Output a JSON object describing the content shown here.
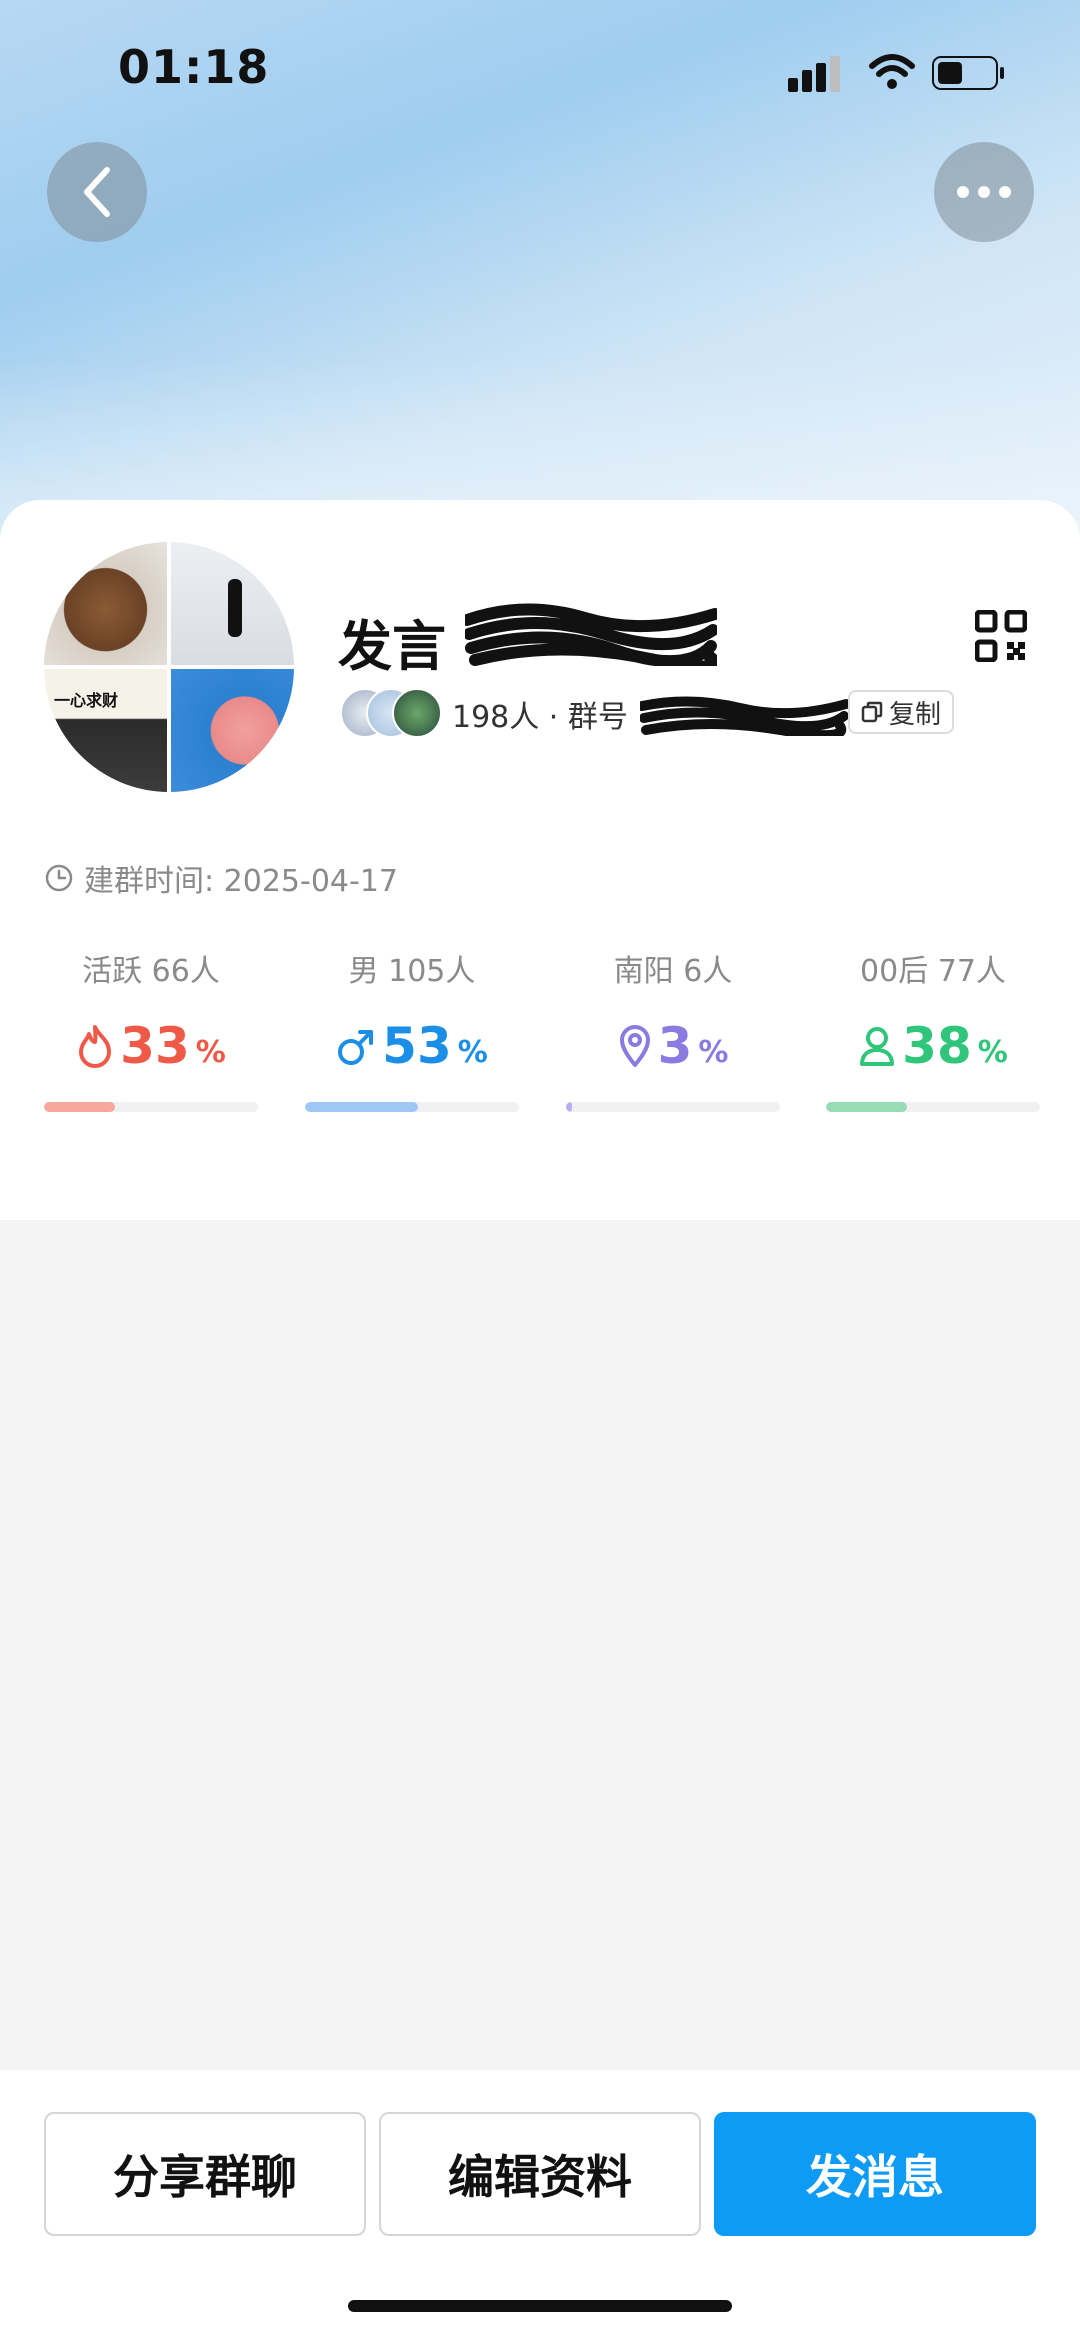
{
  "status_bar": {
    "time": "01:18"
  },
  "header": {
    "back_icon": "chevron-left-icon",
    "more_icon": "ellipsis-icon"
  },
  "group": {
    "name_visible": "发言",
    "members_text": "198人 · 群号",
    "copy_label": "复制",
    "created_label": "建群时间: 2025-04-17"
  },
  "stats": [
    {
      "label": "活跃 66人",
      "percent": "33",
      "percent_value": 33,
      "color": "#ef5a48",
      "bar_color": "#f8a79c",
      "icon": "flame-icon"
    },
    {
      "label": "男 105人",
      "percent": "53",
      "percent_value": 53,
      "color": "#1b8fe8",
      "bar_color": "#9ec7f6",
      "icon": "male-icon"
    },
    {
      "label": "南阳 6人",
      "percent": "3",
      "percent_value": 3,
      "color": "#8b7be0",
      "bar_color": "#b9aef0",
      "icon": "location-pin-icon"
    },
    {
      "label": "00后 77人",
      "percent": "38",
      "percent_value": 38,
      "color": "#2fc57a",
      "bar_color": "#98dcb6",
      "icon": "person-icon"
    }
  ],
  "percent_sign": "%",
  "buttons": {
    "share": "分享群聊",
    "edit": "编辑资料",
    "send": "发消息"
  },
  "avatar_tile_text": "一心求财"
}
